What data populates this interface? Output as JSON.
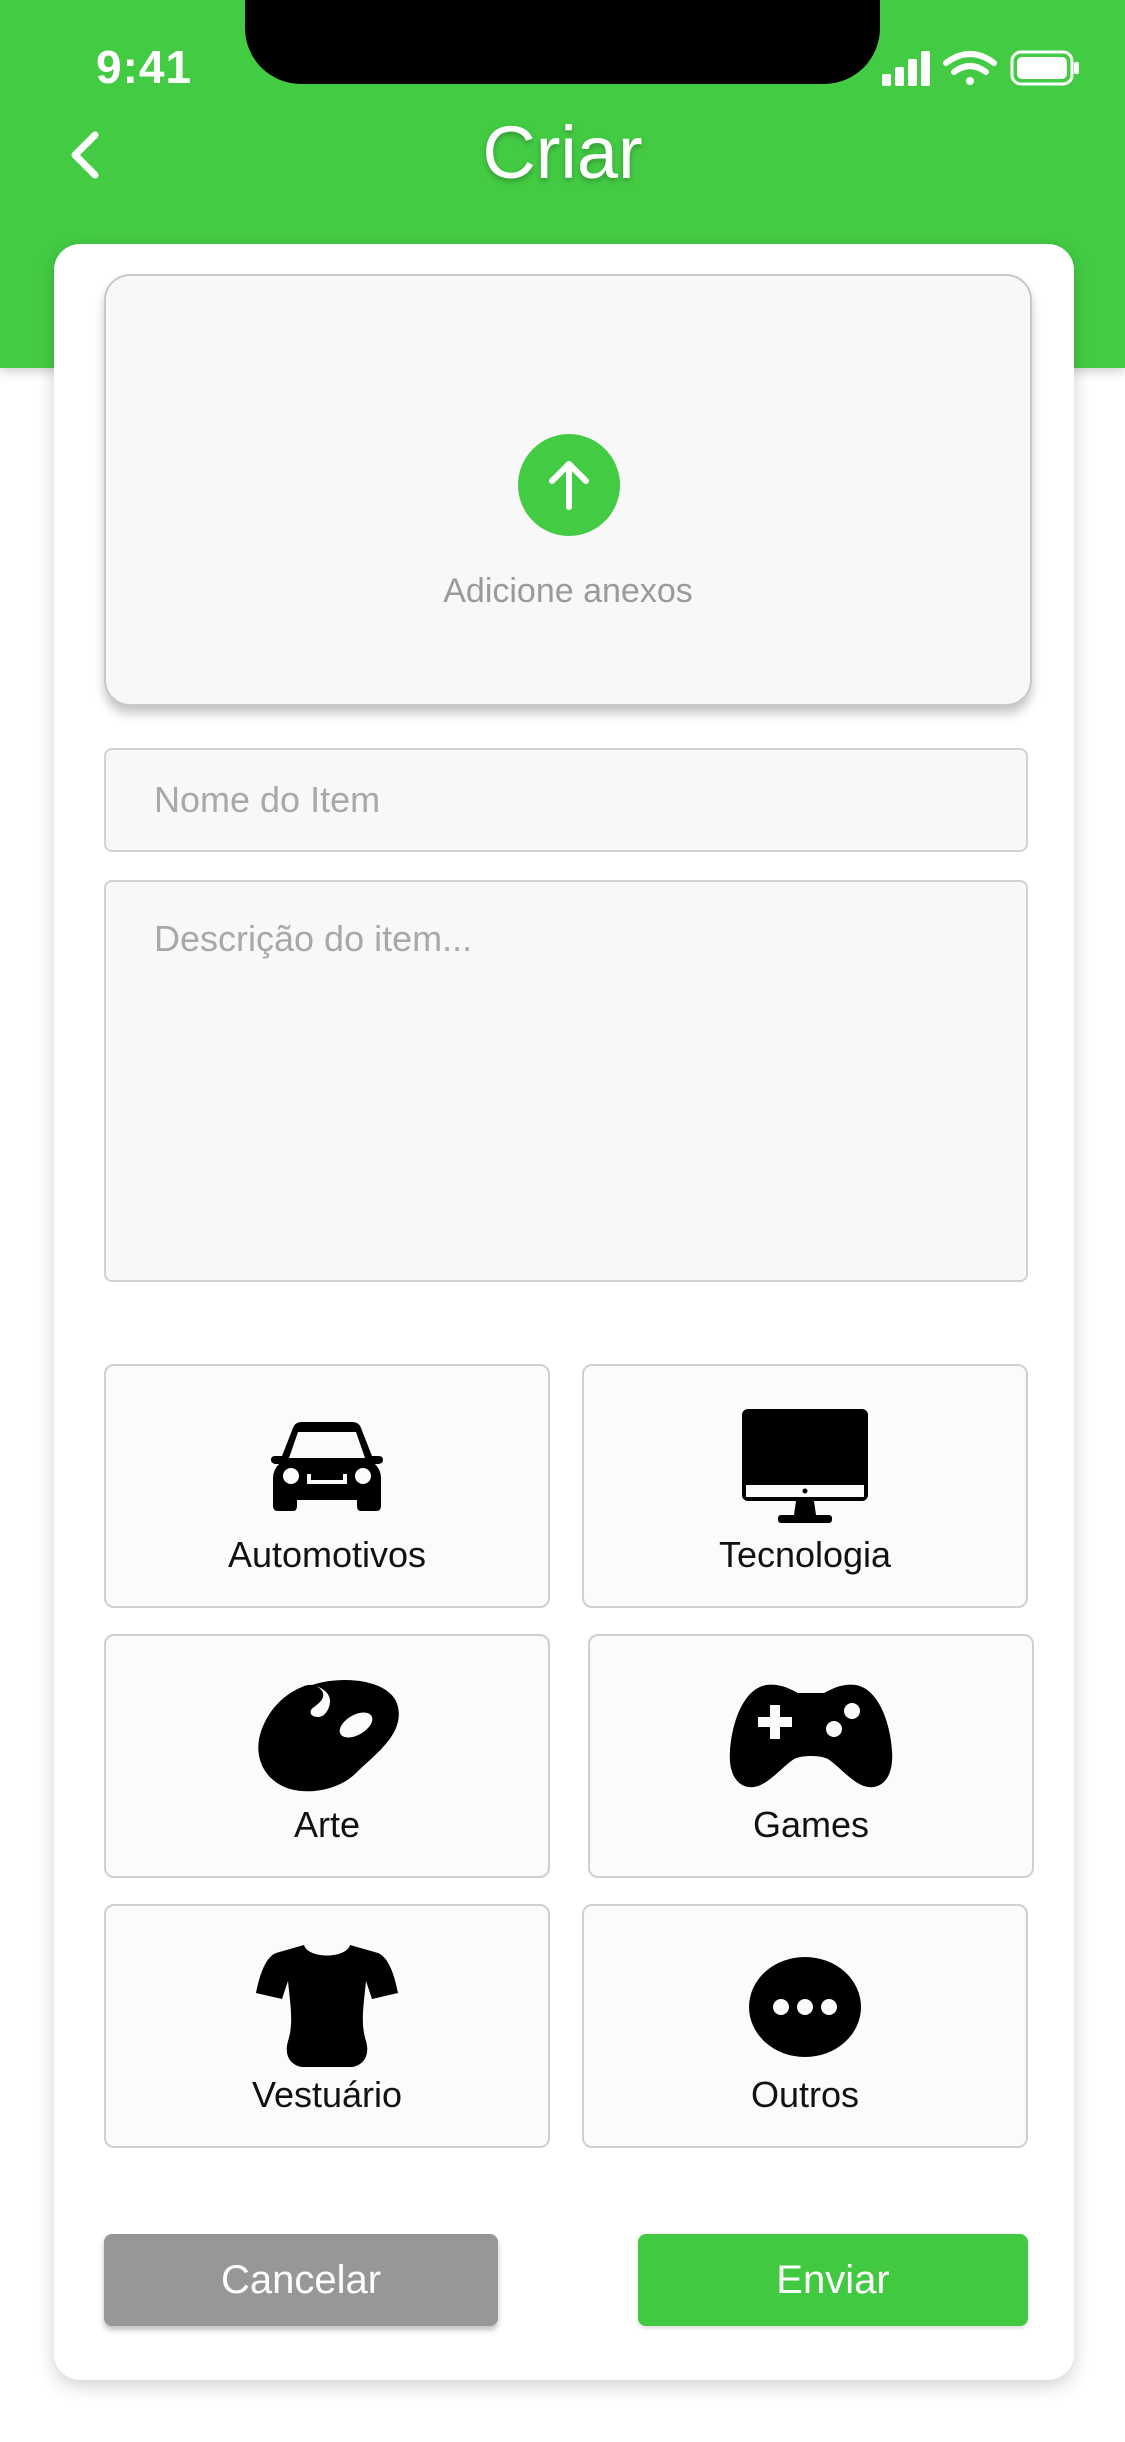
{
  "status_bar": {
    "time": "9:41"
  },
  "header": {
    "title": "Criar"
  },
  "upload": {
    "label": "Adicione anexos"
  },
  "form": {
    "name_placeholder": "Nome do Item",
    "description_placeholder": "Descrição do item..."
  },
  "categories": [
    {
      "label": "Automotivos",
      "icon": "car-icon"
    },
    {
      "label": "Tecnologia",
      "icon": "monitor-icon"
    },
    {
      "label": "Arte",
      "icon": "palette-icon"
    },
    {
      "label": "Games",
      "icon": "gamepad-icon"
    },
    {
      "label": "Vestuário",
      "icon": "shirt-icon"
    },
    {
      "label": "Outros",
      "icon": "more-icon"
    }
  ],
  "actions": {
    "cancel_label": "Cancelar",
    "send_label": "Enviar"
  },
  "colors": {
    "accent": "#44cb44",
    "cancel": "#959895",
    "background": "#ffffff"
  }
}
